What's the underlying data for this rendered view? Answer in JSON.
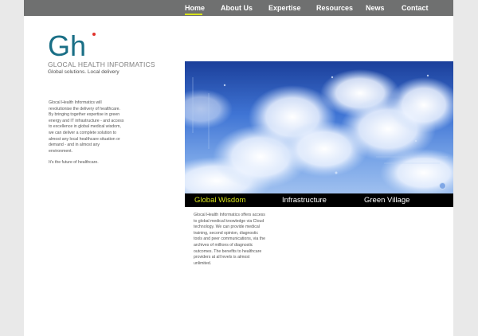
{
  "nav": {
    "items": [
      {
        "label": "Home",
        "active": true
      },
      {
        "label": "About Us"
      },
      {
        "label": "Expertise"
      },
      {
        "label": "Resources"
      },
      {
        "label": "News"
      },
      {
        "label": "Contact"
      }
    ]
  },
  "brand": {
    "logo_text": "Gh",
    "name": "GLOCAL HEALTH INFORMATICS",
    "tagline": "Global solutions. Local delivery"
  },
  "intro": {
    "paragraph": "Glocal Health Informatics will revolutionise the delivery of healthcare. By bringing together expertise in green energy and IT infrastructure - and access to excellence in global medical wisdom, we can deliver a complete solution to almost any local healthcare situation or demand - and in almost any environment.",
    "closing": "It's the future of healthcare."
  },
  "tabs": [
    {
      "label": "Global Wisdom",
      "active": true
    },
    {
      "label": "Infrastructure"
    },
    {
      "label": "Green Village"
    }
  ],
  "content": {
    "description": "Glocal Health Informatics offers access to global medical knowledge via Cloud technology. We can provide medical training, second opinion, diagnostic tools and peer communications, via the archives of millions of diagnostic outcomes. The benefits to healthcare providers at all levels is almost unlimited."
  },
  "colors": {
    "nav_bg": "#6f7070",
    "accent": "#d6e21a",
    "logo_teal": "#1a6f86",
    "logo_dot": "#e0322b",
    "tab_bar": "#000000"
  }
}
